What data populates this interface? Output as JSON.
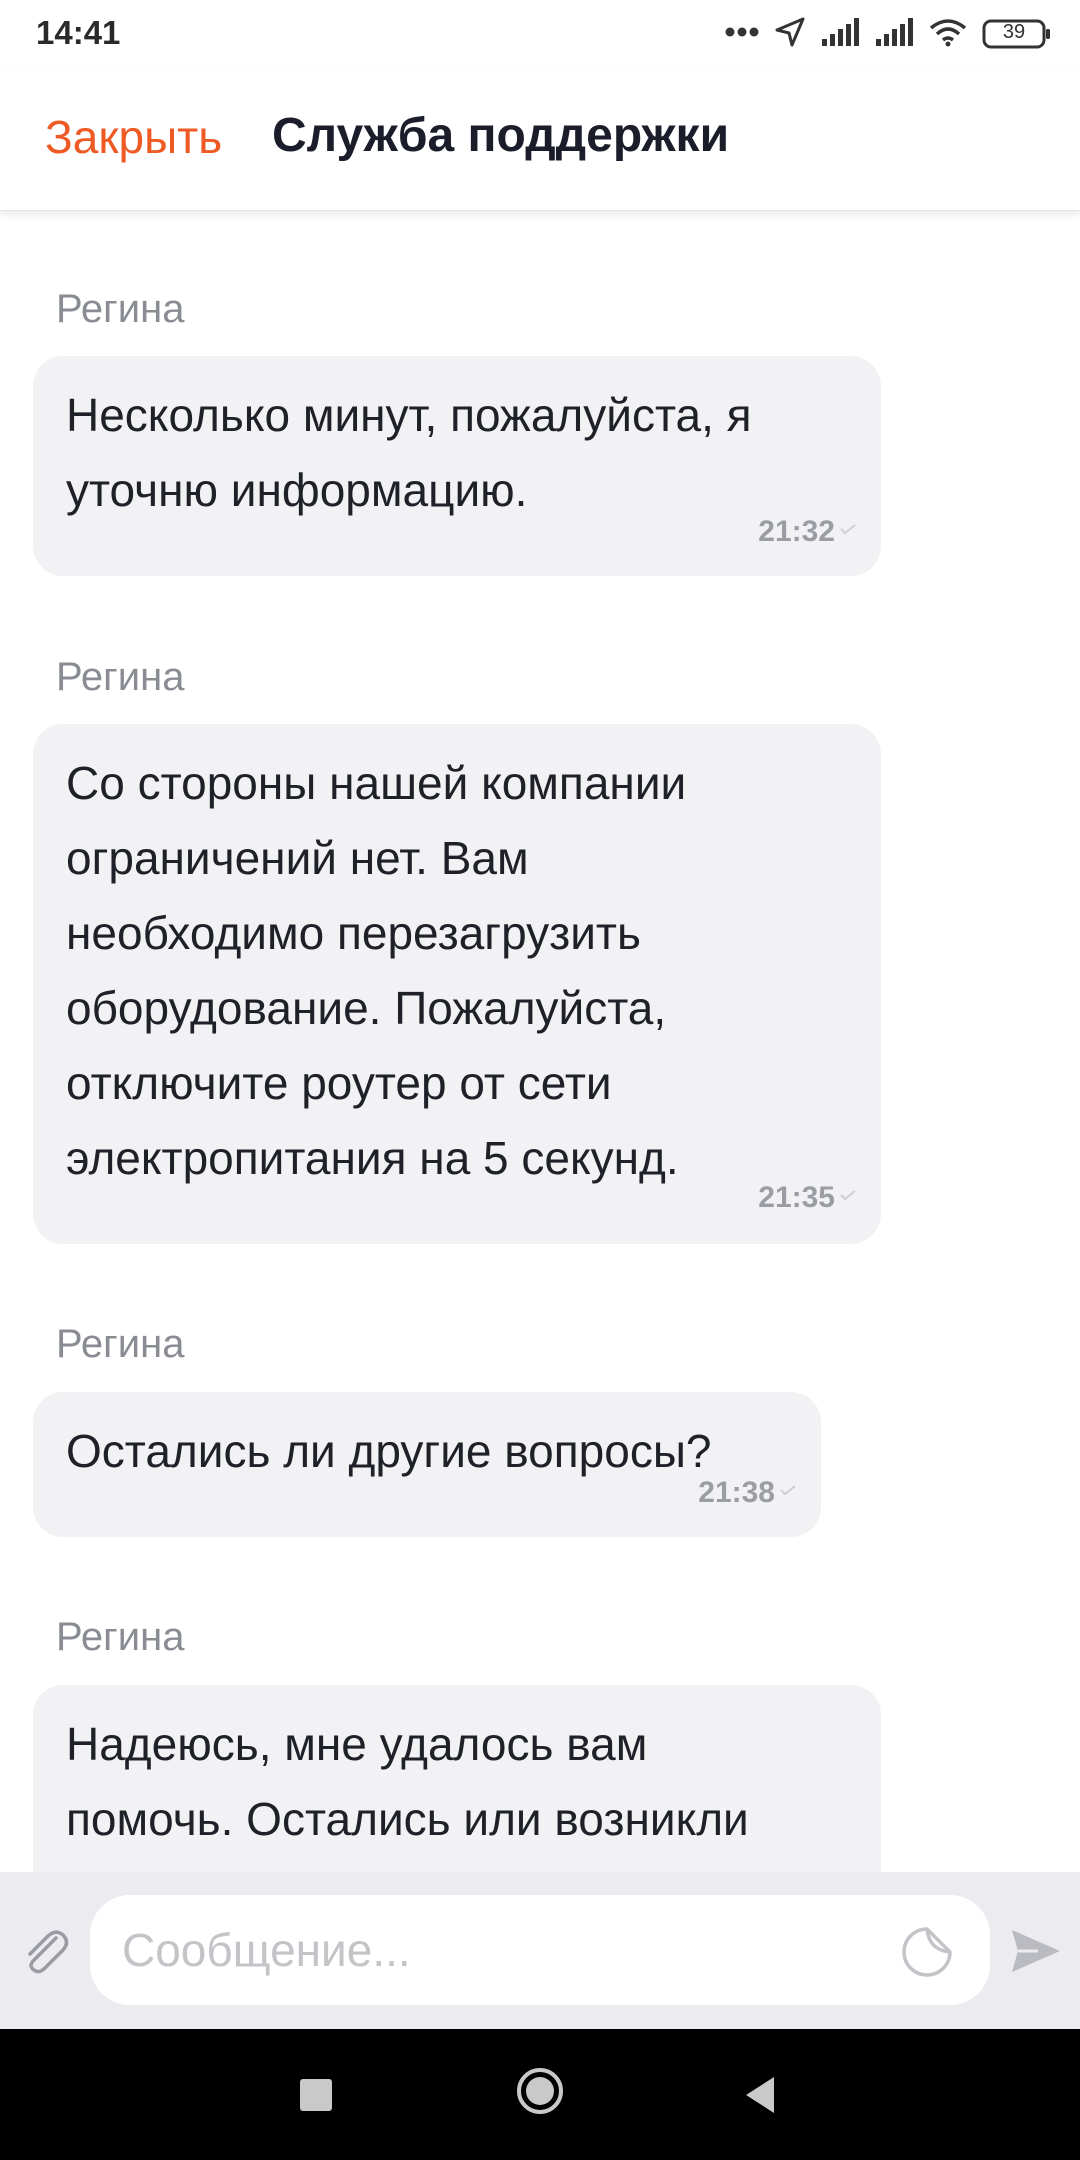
{
  "status_bar": {
    "time": "14:41",
    "battery": "39",
    "icons": [
      "more-dots-icon",
      "location-arrow-icon",
      "signal-icon",
      "signal-icon",
      "wifi-icon",
      "battery-icon"
    ]
  },
  "header": {
    "close_label": "Закрыть",
    "title": "Служба поддержки"
  },
  "messages": [
    {
      "sender": "Регина",
      "text": "Несколько минут, пожалуйста, я\nуточню информацию.",
      "time": "21:32"
    },
    {
      "sender": "Регина",
      "text": "Со стороны нашей компании\nограничений нет. Вам\nнеобходимо перезагрузить\nоборудование. Пожалуйста,\nотключите роутер от сети\nэлектропитания на 5 секунд.",
      "time": "21:35"
    },
    {
      "sender": "Регина",
      "text": "Остались ли другие вопросы?",
      "time": "21:38"
    },
    {
      "sender": "Регина",
      "text": "Надеюсь, мне удалось вам\nпомочь. Остались или возникли",
      "time": ""
    }
  ],
  "composer": {
    "placeholder": "Сообщение..."
  },
  "colors": {
    "accent": "#ee5a24",
    "bubble": "#f2f2f4",
    "composer_bg": "#ececf0"
  }
}
